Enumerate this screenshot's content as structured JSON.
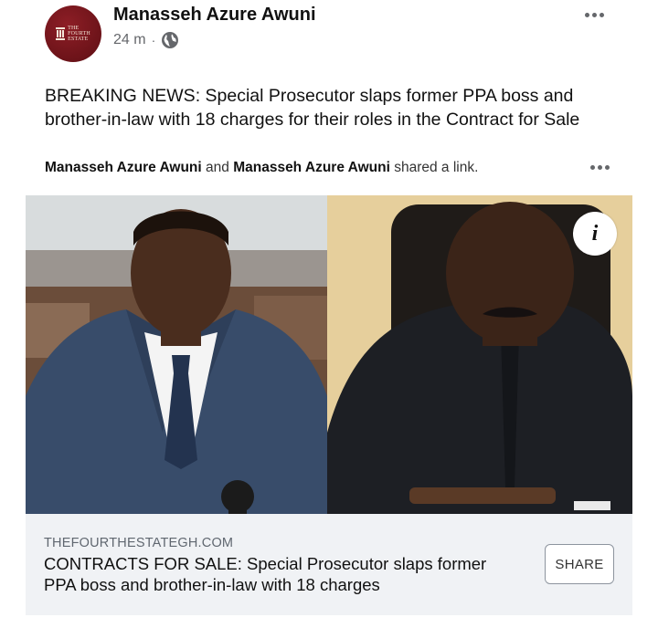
{
  "post": {
    "author": "Manasseh Azure Awuni",
    "timestamp": "24 m",
    "separator": "·",
    "privacy_icon": "globe-icon",
    "avatar_logo_text": "THE FOURTH ESTATE",
    "more_icon": "more-horizontal-icon",
    "text": "BREAKING NEWS: Special Prosecutor slaps former PPA boss and brother-in-law with 18 charges for their roles in the Contract for Sale"
  },
  "shared": {
    "name1": "Manasseh Azure Awuni",
    "and": "and",
    "name2": "Manasseh Azure Awuni",
    "suffix": "shared a link."
  },
  "link": {
    "domain": "THEFOURTHESTATEGH.COM",
    "title": "CONTRACTS FOR SALE: Special Prosecutor slaps former PPA boss and brother-in-law with 18 charges",
    "share_label": "SHARE",
    "info_label": "i",
    "image_description_icon": "news-photo"
  },
  "colors": {
    "avatar": "#6c1319",
    "meta_gray": "#65676b",
    "card_bg": "#f0f2f5"
  }
}
